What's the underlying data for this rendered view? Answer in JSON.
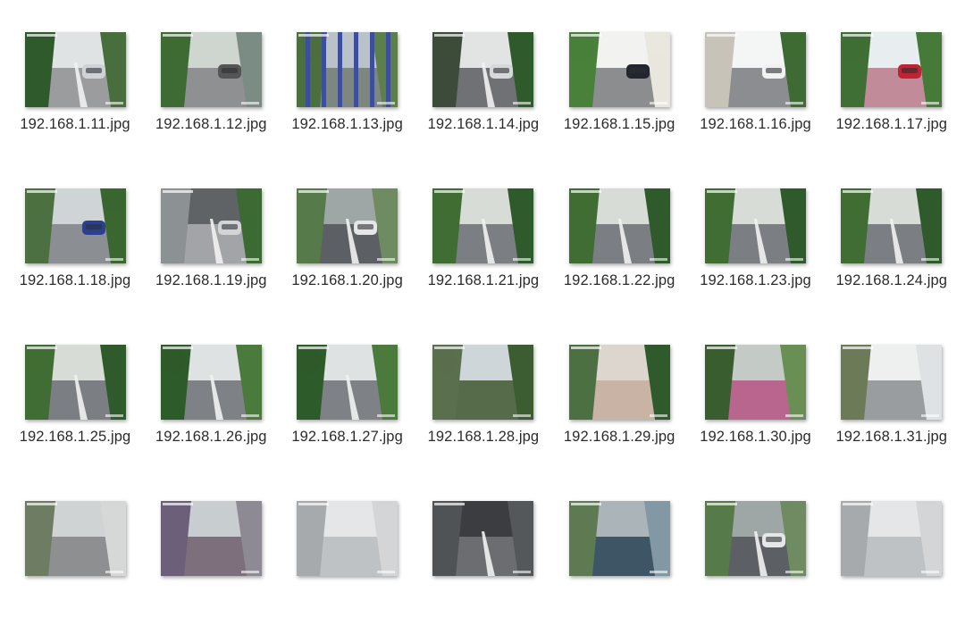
{
  "files": [
    {
      "name": "192.168.1.11.jpg",
      "icon": "cctv-thumbnail-icon",
      "scene": "parking"
    },
    {
      "name": "192.168.1.12.jpg",
      "icon": "cctv-thumbnail-icon",
      "scene": "gate"
    },
    {
      "name": "192.168.1.13.jpg",
      "icon": "cctv-thumbnail-icon",
      "scene": "fence"
    },
    {
      "name": "192.168.1.14.jpg",
      "icon": "cctv-thumbnail-icon",
      "scene": "road-car"
    },
    {
      "name": "192.168.1.15.jpg",
      "icon": "cctv-thumbnail-icon",
      "scene": "car-lawn"
    },
    {
      "name": "192.168.1.16.jpg",
      "icon": "cctv-thumbnail-icon",
      "scene": "road-building"
    },
    {
      "name": "192.168.1.17.jpg",
      "icon": "cctv-thumbnail-icon",
      "scene": "pink-road"
    },
    {
      "name": "192.168.1.18.jpg",
      "icon": "cctv-thumbnail-icon",
      "scene": "cars-close"
    },
    {
      "name": "192.168.1.19.jpg",
      "icon": "cctv-thumbnail-icon",
      "scene": "garage"
    },
    {
      "name": "192.168.1.20.jpg",
      "icon": "cctv-thumbnail-icon",
      "scene": "lot"
    },
    {
      "name": "192.168.1.21.jpg",
      "icon": "cctv-thumbnail-icon",
      "scene": "road-green"
    },
    {
      "name": "192.168.1.22.jpg",
      "icon": "cctv-thumbnail-icon",
      "scene": "road-green"
    },
    {
      "name": "192.168.1.23.jpg",
      "icon": "cctv-thumbnail-icon",
      "scene": "road-green"
    },
    {
      "name": "192.168.1.24.jpg",
      "icon": "cctv-thumbnail-icon",
      "scene": "road-green"
    },
    {
      "name": "192.168.1.25.jpg",
      "icon": "cctv-thumbnail-icon",
      "scene": "road-green"
    },
    {
      "name": "192.168.1.26.jpg",
      "icon": "cctv-thumbnail-icon",
      "scene": "curve"
    },
    {
      "name": "192.168.1.27.jpg",
      "icon": "cctv-thumbnail-icon",
      "scene": "curve"
    },
    {
      "name": "192.168.1.28.jpg",
      "icon": "cctv-thumbnail-icon",
      "scene": "trees"
    },
    {
      "name": "192.168.1.29.jpg",
      "icon": "cctv-thumbnail-icon",
      "scene": "path"
    },
    {
      "name": "192.168.1.30.jpg",
      "icon": "cctv-thumbnail-icon",
      "scene": "pink-path"
    },
    {
      "name": "192.168.1.31.jpg",
      "icon": "cctv-thumbnail-icon",
      "scene": "wall"
    },
    {
      "name": "",
      "icon": "cctv-thumbnail-icon",
      "scene": "building"
    },
    {
      "name": "",
      "icon": "cctv-thumbnail-icon",
      "scene": "flowers"
    },
    {
      "name": "",
      "icon": "cctv-thumbnail-icon",
      "scene": "indoor"
    },
    {
      "name": "",
      "icon": "cctv-thumbnail-icon",
      "scene": "dark-garage"
    },
    {
      "name": "",
      "icon": "cctv-thumbnail-icon",
      "scene": "water"
    },
    {
      "name": "",
      "icon": "cctv-thumbnail-icon",
      "scene": "lot"
    },
    {
      "name": "",
      "icon": "cctv-thumbnail-icon",
      "scene": "indoor"
    }
  ],
  "colors": {
    "label_text": "#2b2b2b",
    "road": "#8d8f93",
    "greenery": "#3f6a35",
    "sky": "#d9dde0"
  }
}
